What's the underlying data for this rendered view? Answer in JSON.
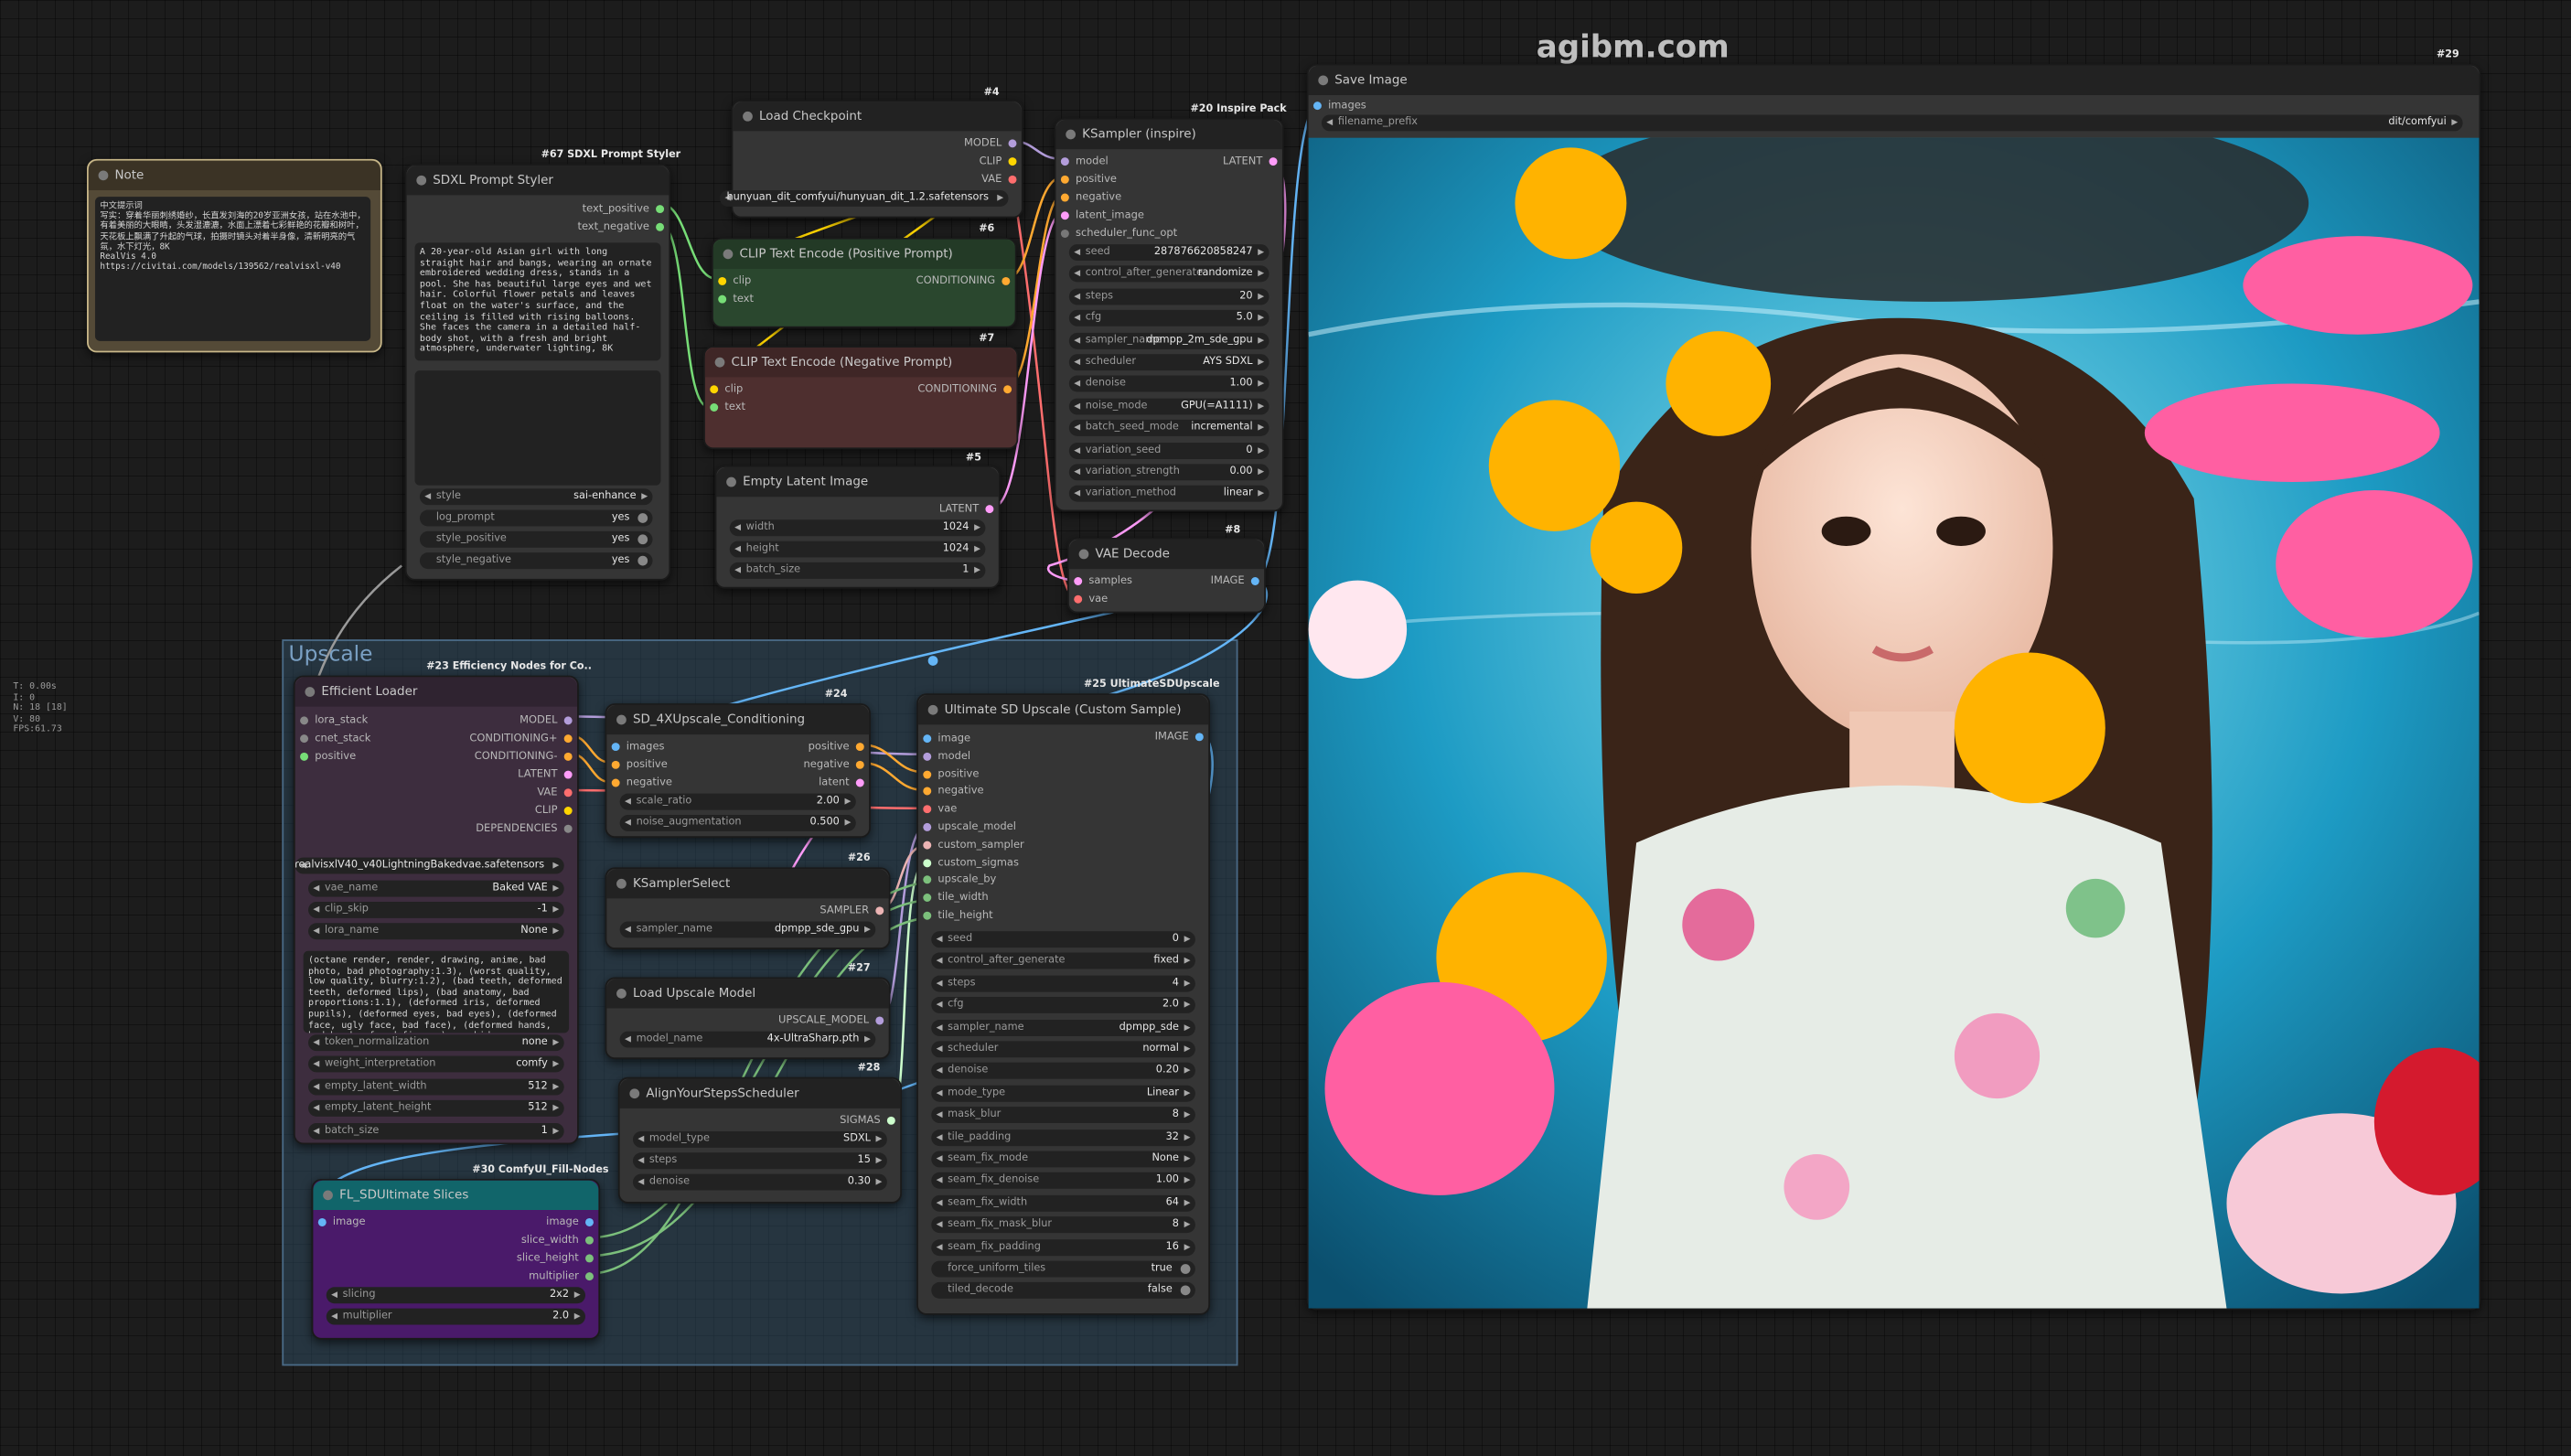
{
  "watermark": "agibm.com",
  "stats": [
    "T: 0.00s",
    "I: 0",
    "N: 18 [18]",
    "V: 80",
    "FPS:61.73"
  ],
  "colors": {
    "model": "#b39ddb",
    "clip": "#ffd500",
    "vae": "#ff6e6e",
    "conditioning": "#ffa931",
    "latent": "#ff9cf9",
    "image": "#64b5f6",
    "sampler": "#ecb4b4",
    "sigmas": "#cdffcd",
    "int": "#7cc07c",
    "string": "#77dd77"
  },
  "note": {
    "title": "Note",
    "text": "中文提示词\n写实：穿着华丽刺绣婚纱，长直发刘海的20岁亚洲女孩，站在水池中，有着美丽的大眼睛，头发湿漉漉，水面上漂着七彩鲜艳的花瓣和树叶，天花板上飘满了升起的气球，拍摄时镜头对着半身像，清新明亮的气氛，水下灯光，8K\nRealVis 4.0\nhttps://civitai.com/models/139562/realvisxl-v40"
  },
  "styler": {
    "badge": "#67 SDXL Prompt Styler",
    "title": "SDXL Prompt Styler",
    "outputs": [
      "text_positive",
      "text_negative"
    ],
    "prompt": "A 20-year-old Asian girl with long straight hair and bangs, wearing an ornate embroidered wedding dress, stands in a pool. She has beautiful large eyes and wet hair. Colorful flower petals and leaves float on the water's surface, and the ceiling is filled with rising balloons. She faces the camera in a detailed half-body shot, with a fresh and bright atmosphere, underwater lighting, 8K",
    "widgets": [
      {
        "label": "style",
        "value": "sai-enhance"
      },
      {
        "label": "log_prompt",
        "value": "yes"
      },
      {
        "label": "style_positive",
        "value": "yes"
      },
      {
        "label": "style_negative",
        "value": "yes"
      }
    ]
  },
  "checkpoint": {
    "badge": "#4",
    "title": "Load Checkpoint",
    "outputs": [
      "MODEL",
      "CLIP",
      "VAE"
    ],
    "ckpt_name": "hunyuan_dit_comfyui/hunyuan_dit_1.2.safetensors"
  },
  "clip_pos": {
    "badge": "#6",
    "title": "CLIP Text Encode (Positive Prompt)",
    "inputs": [
      "clip",
      "text"
    ],
    "output": "CONDITIONING"
  },
  "clip_neg": {
    "badge": "#7",
    "title": "CLIP Text Encode (Negative Prompt)",
    "inputs": [
      "clip",
      "text"
    ],
    "output": "CONDITIONING"
  },
  "latent": {
    "badge": "#5",
    "title": "Empty Latent Image",
    "output": "LATENT",
    "widgets": [
      {
        "label": "width",
        "value": "1024"
      },
      {
        "label": "height",
        "value": "1024"
      },
      {
        "label": "batch_size",
        "value": "1"
      }
    ]
  },
  "ksampler": {
    "badge": "#20 Inspire Pack",
    "title": "KSampler (inspire)",
    "inputs": [
      "model",
      "positive",
      "negative",
      "latent_image",
      "scheduler_func_opt"
    ],
    "output": "LATENT",
    "widgets": [
      {
        "label": "seed",
        "value": "287876620858247"
      },
      {
        "label": "control_after_generate",
        "value": "randomize"
      },
      {
        "label": "steps",
        "value": "20"
      },
      {
        "label": "cfg",
        "value": "5.0"
      },
      {
        "label": "sampler_name",
        "value": "dpmpp_2m_sde_gpu"
      },
      {
        "label": "scheduler",
        "value": "AYS SDXL"
      },
      {
        "label": "denoise",
        "value": "1.00"
      },
      {
        "label": "noise_mode",
        "value": "GPU(=A1111)"
      },
      {
        "label": "batch_seed_mode",
        "value": "incremental"
      },
      {
        "label": "variation_seed",
        "value": "0"
      },
      {
        "label": "variation_strength",
        "value": "0.00"
      },
      {
        "label": "variation_method",
        "value": "linear"
      }
    ]
  },
  "vae_decode": {
    "badge": "#8",
    "title": "VAE Decode",
    "inputs": [
      "samples",
      "vae"
    ],
    "output": "IMAGE"
  },
  "save": {
    "badge": "#29",
    "title": "Save Image",
    "input": "images",
    "filename_label": "filename_prefix",
    "filename_value": "dit/comfyui"
  },
  "group": {
    "title": "Upscale"
  },
  "efficient": {
    "badge": "#23 Efficiency Nodes for Co..",
    "title": "Efficient Loader",
    "inputs": [
      "lora_stack",
      "cnet_stack",
      "positive"
    ],
    "outputs": [
      "MODEL",
      "CONDITIONING+",
      "CONDITIONING-",
      "LATENT",
      "VAE",
      "CLIP",
      "DEPENDENCIES"
    ],
    "ckpt_name": "realvisxlV40_v40LightningBakedvae.safetensors",
    "widgets": [
      {
        "label": "vae_name",
        "value": "Baked VAE"
      },
      {
        "label": "clip_skip",
        "value": "-1"
      },
      {
        "label": "lora_name",
        "value": "None"
      }
    ],
    "negative": "(octane render, render, drawing, anime, bad photo, bad photography:1.3), (worst quality, low quality, blurry:1.2), (bad teeth, deformed teeth, deformed lips), (bad anatomy, bad proportions:1.1), (deformed iris, deformed pupils), (deformed eyes, bad eyes), (deformed face, ugly face, bad face), (deformed hands, bad hands, fused fingers), morbid,",
    "widgets2": [
      {
        "label": "token_normalization",
        "value": "none"
      },
      {
        "label": "weight_interpretation",
        "value": "comfy"
      },
      {
        "label": "empty_latent_width",
        "value": "512"
      },
      {
        "label": "empty_latent_height",
        "value": "512"
      },
      {
        "label": "batch_size",
        "value": "1"
      }
    ]
  },
  "sd4x": {
    "badge": "#24",
    "title": "SD_4XUpscale_Conditioning",
    "inputs": [
      "images",
      "positive",
      "negative"
    ],
    "outputs": [
      "positive",
      "negative",
      "latent"
    ],
    "widgets": [
      {
        "label": "scale_ratio",
        "value": "2.00"
      },
      {
        "label": "noise_augmentation",
        "value": "0.500"
      }
    ]
  },
  "ksamplerselect": {
    "badge": "#26",
    "title": "KSamplerSelect",
    "output": "SAMPLER",
    "widgets": [
      {
        "label": "sampler_name",
        "value": "dpmpp_sde_gpu"
      }
    ]
  },
  "upscale_model": {
    "badge": "#27",
    "title": "Load Upscale Model",
    "output": "UPSCALE_MODEL",
    "widgets": [
      {
        "label": "model_name",
        "value": "4x-UltraSharp.pth"
      }
    ]
  },
  "ays": {
    "badge": "#28",
    "title": "AlignYourStepsScheduler",
    "output": "SIGMAS",
    "widgets": [
      {
        "label": "model_type",
        "value": "SDXL"
      },
      {
        "label": "steps",
        "value": "15"
      },
      {
        "label": "denoise",
        "value": "0.30"
      }
    ]
  },
  "ultimate": {
    "badge": "#25 UltimateSDUpscale",
    "title": "Ultimate SD Upscale (Custom Sample)",
    "output": "IMAGE",
    "inputs": [
      "image",
      "model",
      "positive",
      "negative",
      "vae",
      "upscale_model",
      "custom_sampler",
      "custom_sigmas",
      "upscale_by",
      "tile_width",
      "tile_height"
    ],
    "widgets": [
      {
        "label": "seed",
        "value": "0"
      },
      {
        "label": "control_after_generate",
        "value": "fixed"
      },
      {
        "label": "steps",
        "value": "4"
      },
      {
        "label": "cfg",
        "value": "2.0"
      },
      {
        "label": "sampler_name",
        "value": "dpmpp_sde"
      },
      {
        "label": "scheduler",
        "value": "normal"
      },
      {
        "label": "denoise",
        "value": "0.20"
      },
      {
        "label": "mode_type",
        "value": "Linear"
      },
      {
        "label": "mask_blur",
        "value": "8"
      },
      {
        "label": "tile_padding",
        "value": "32"
      },
      {
        "label": "seam_fix_mode",
        "value": "None"
      },
      {
        "label": "seam_fix_denoise",
        "value": "1.00"
      },
      {
        "label": "seam_fix_width",
        "value": "64"
      },
      {
        "label": "seam_fix_mask_blur",
        "value": "8"
      },
      {
        "label": "seam_fix_padding",
        "value": "16"
      }
    ],
    "toggles": [
      {
        "label": "force_uniform_tiles",
        "value": "true"
      },
      {
        "label": "tiled_decode",
        "value": "false"
      }
    ]
  },
  "fl": {
    "badge": "#30 ComfyUI_Fill-Nodes",
    "title": "FL_SDUltimate Slices",
    "input": "image",
    "outputs": [
      "image",
      "slice_width",
      "slice_height",
      "multiplier"
    ],
    "widgets": [
      {
        "label": "slicing",
        "value": "2x2"
      },
      {
        "label": "multiplier",
        "value": "2.0"
      }
    ]
  }
}
